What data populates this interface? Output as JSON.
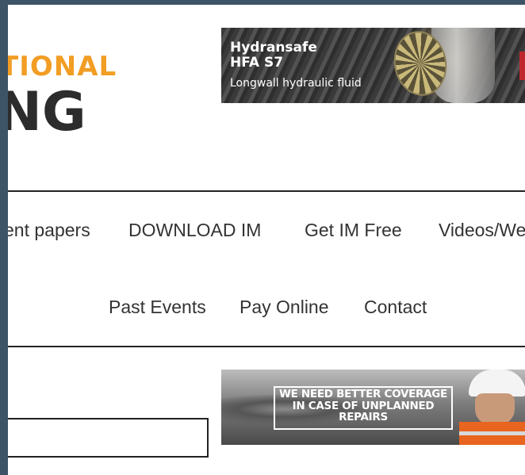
{
  "logo": {
    "line1": "TIONAL",
    "line2": "NG"
  },
  "ads": {
    "top": {
      "title1": "Hydransafe",
      "title2": "HFA S7",
      "subtitle": "Longwall hydraulic fluid"
    },
    "bottom": {
      "headline": "WE NEED BETTER COVERAGE IN CASE OF UNPLANNED REPAIRS"
    }
  },
  "nav": {
    "row1": [
      "ent papers",
      "DOWNLOAD IM",
      "Get IM Free",
      "Videos/We"
    ],
    "row2": [
      "Past Events",
      "Pay Online",
      "Contact"
    ]
  },
  "search": {
    "value": ""
  },
  "colors": {
    "frame": "#3d5366",
    "logo_orange": "#f29d24",
    "logo_dark": "#2c2c2c",
    "text": "#333333"
  }
}
